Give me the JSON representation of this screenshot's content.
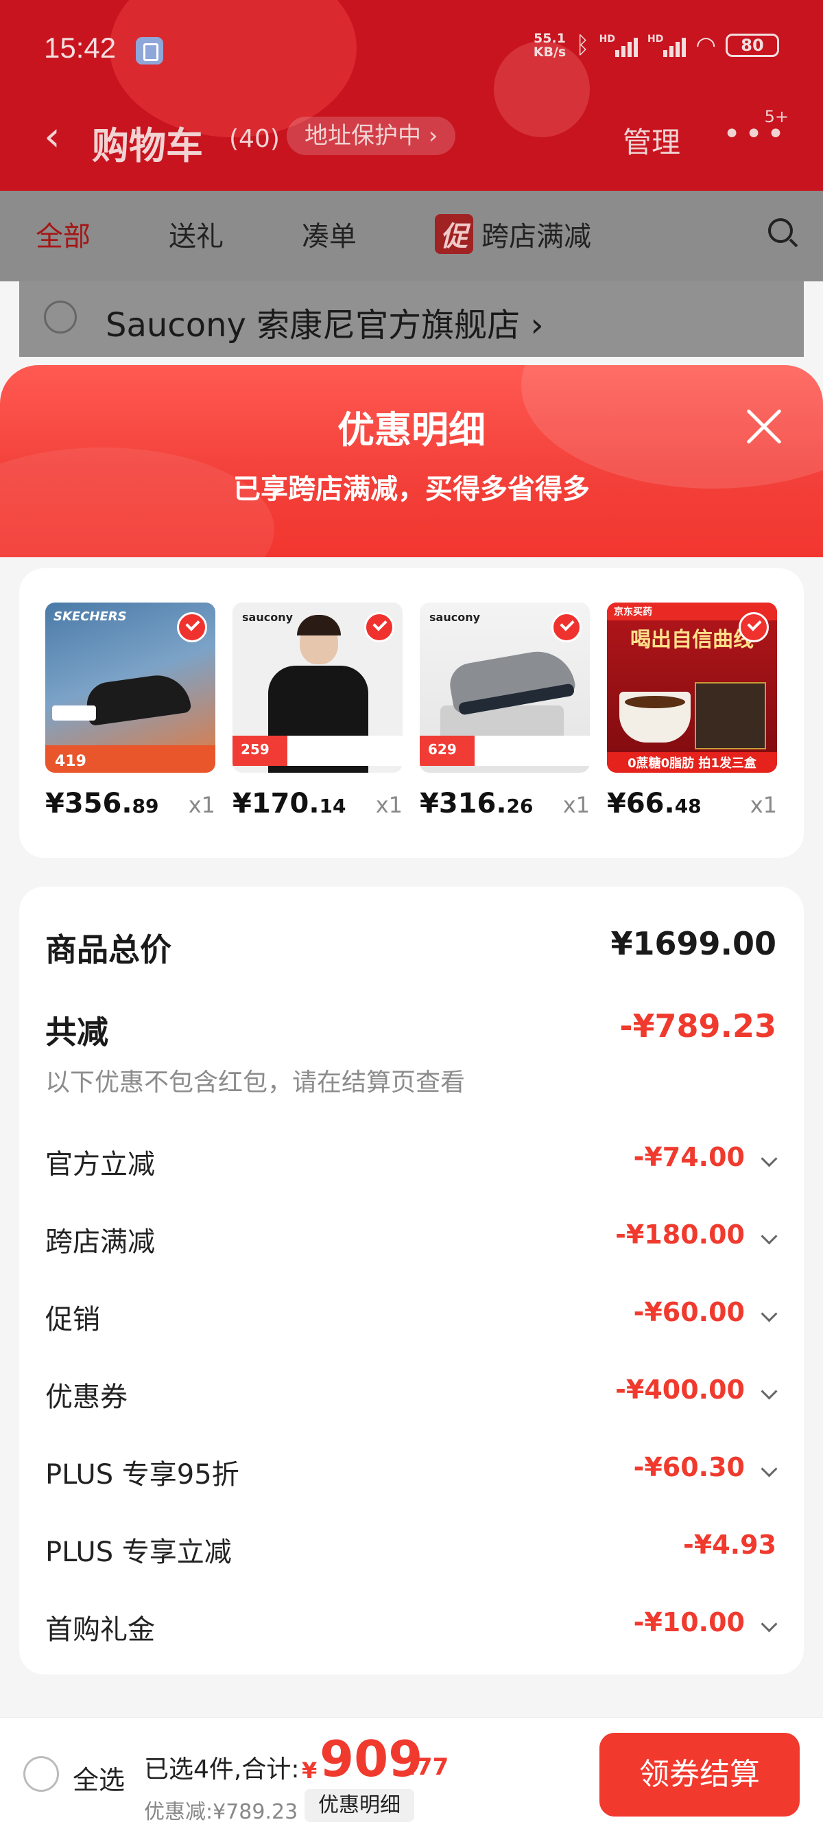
{
  "status_bar": {
    "time": "15:42",
    "net_speed_top": "55.1",
    "net_speed_unit": "KB/s",
    "hd1": "HD",
    "hd2": "HD",
    "battery": "80"
  },
  "nav": {
    "back_icon": "chevron-left-icon",
    "title": "购物车",
    "count": "(40)",
    "address_protection": "地址保护中 ›",
    "manage": "管理",
    "more_badge": "5+"
  },
  "tabs": {
    "all": "全部",
    "gift": "送礼",
    "bundle": "凑单",
    "cu_badge": "促",
    "cross_store": "跨店满减"
  },
  "store": {
    "name": "Saucony 索康尼官方旗舰店 ›"
  },
  "sheet": {
    "title": "优惠明细",
    "subtitle": "已享跨店满减，买得多省得多"
  },
  "products": [
    {
      "price_int": "¥356.",
      "price_dec": "89",
      "qty": "x1",
      "thumb": {
        "brand": "SKECHERS",
        "price_tag": "419"
      }
    },
    {
      "price_int": "¥170.",
      "price_dec": "14",
      "qty": "x1",
      "thumb": {
        "brand": "saucony",
        "price_tag": "259"
      }
    },
    {
      "price_int": "¥316.",
      "price_dec": "26",
      "qty": "x1",
      "thumb": {
        "brand": "saucony",
        "price_tag": "629"
      }
    },
    {
      "price_int": "¥66.",
      "price_dec": "48",
      "qty": "x1",
      "thumb": {
        "brand": "京东买药",
        "headline": "喝出自信曲线",
        "footer": "0蔗糖0脂肪 拍1发三盒"
      }
    }
  ],
  "breakdown": {
    "total_label": "商品总价",
    "total_value": "¥1699.00",
    "reduction_label": "共减",
    "reduction_value": "-¥789.23",
    "note": "以下优惠不包含红包，请在结算页查看",
    "rows": [
      {
        "label": "官方立减",
        "value": "-¥74.00"
      },
      {
        "label": "跨店满减",
        "value": "-¥180.00"
      },
      {
        "label": "促销",
        "value": "-¥60.00"
      },
      {
        "label": "优惠券",
        "value": "-¥400.00"
      },
      {
        "label": "PLUS 专享95折",
        "value": "-¥60.30"
      },
      {
        "label": "PLUS 专享立减",
        "value": "-¥4.93"
      },
      {
        "label": "首购礼金",
        "value": "-¥10.00"
      }
    ]
  },
  "bottom": {
    "select_all": "全选",
    "summary_label": "已选4件,合计:",
    "yen": "¥",
    "total_int": "909",
    "total_dec": ".77",
    "discount_label": "优惠减:¥789.23",
    "detail_button": "优惠明细",
    "checkout_button": "领券结算"
  },
  "colors": {
    "accent_red": "#f03a2e",
    "header_red": "#c8141f"
  }
}
